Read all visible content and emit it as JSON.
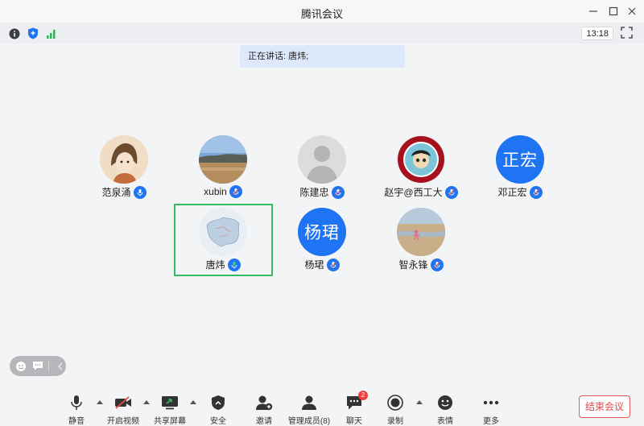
{
  "window": {
    "title": "腾讯会议"
  },
  "status": {
    "clock": "13:18"
  },
  "speaking": {
    "text": "正在讲话: 唐炜;"
  },
  "participants": [
    {
      "name": "范泉涌",
      "avatar": "cartoon-portrait",
      "mic": "unmuted"
    },
    {
      "name": "xubin",
      "avatar": "landscape-photo",
      "mic": "muted"
    },
    {
      "name": "陈建忠",
      "avatar": "default-silhouette",
      "mic": "muted"
    },
    {
      "name": "赵宇@西工大",
      "avatar": "university-seal-portrait",
      "mic": "muted"
    },
    {
      "name": "邓正宏",
      "avatar_text": "正宏",
      "mic": "muted"
    },
    {
      "name": "唐炜",
      "avatar": "map-image",
      "mic": "speaking"
    },
    {
      "name": "杨珺",
      "avatar_text": "杨珺",
      "mic": "muted"
    },
    {
      "name": "智永锋",
      "avatar": "beach-photo",
      "mic": "muted"
    }
  ],
  "toolbar": {
    "mute": "静音",
    "video": "开启视频",
    "share": "共享屏幕",
    "security": "安全",
    "invite": "邀请",
    "members": "管理成员(8)",
    "chat": "聊天",
    "chat_badge": "2",
    "record": "录制",
    "reactions": "表情",
    "more": "更多",
    "end": "结束会议"
  },
  "colors": {
    "accent": "#1e74f2",
    "speaking": "#38b865",
    "danger": "#e24848"
  }
}
